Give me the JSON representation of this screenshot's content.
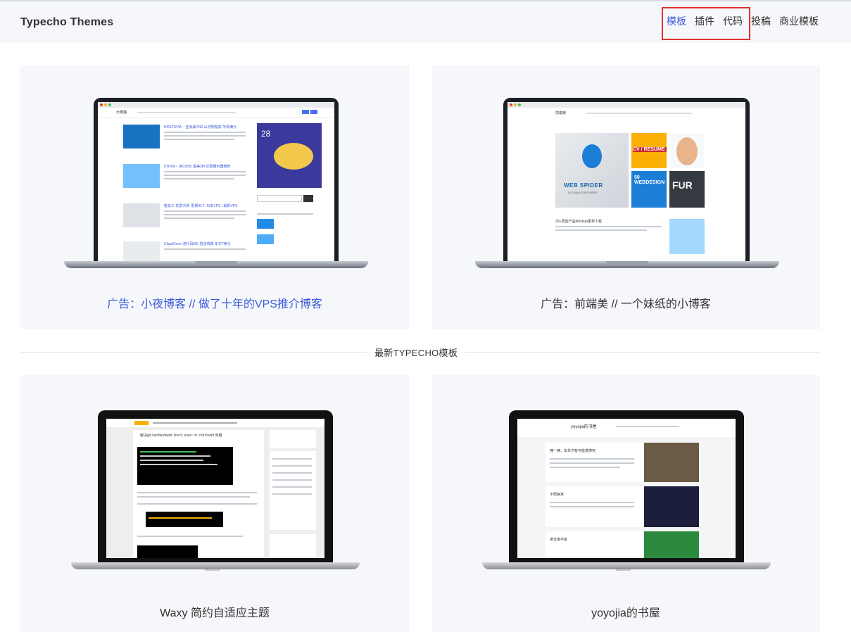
{
  "header": {
    "site_title": "Typecho Themes",
    "nav": [
      {
        "label": "模板",
        "active": true
      },
      {
        "label": "插件",
        "active": false
      },
      {
        "label": "代码",
        "active": false
      },
      {
        "label": "投稿",
        "active": false
      },
      {
        "label": "商业模板",
        "active": false
      }
    ]
  },
  "ads": [
    {
      "caption": "广告：小夜博客 // 做了十年的VPS推介博客",
      "is_link": true
    },
    {
      "caption": "广告：前端美 // 一个妹纸的小博客",
      "is_link": false
    }
  ],
  "section_title": "最新TYPECHO模板",
  "themes": [
    {
      "caption": "Waxy 简约自适应主题"
    },
    {
      "caption": "yoyojia的书屋"
    }
  ],
  "previews": {
    "card1": {
      "logo": "大眼猫",
      "date": "28",
      "posts": [
        "HOSTKVM – 亚洲最CN2 山河物理商 所得满元",
        "DIYVM – 用038元 最美2M 优惠服务器推荐",
        "搬瓦工 优惠75折 限量32个 日本VPS / 最新VPS",
        "CloudCone 洛杉矶MC 直送线路 年付7美元"
      ]
    },
    "card2": {
      "logo": "前端美",
      "post": "20+原创产品Mockup素材下载",
      "logo_text": "WEB SPIDER",
      "logo_sub": "SLOGAN GOES HERE",
      "tiles": [
        "CV / RESUME",
        "50 WEBDESIGN",
        "FUR"
      ]
    },
    "card3": {
      "title": "解决git /usr/bin/bash: line 0: exec: nc: not found 问题",
      "brand": "MacBook"
    },
    "card4": {
      "title": "yoyojia的书屋",
      "posts": [
        "拥一拥，年年才有可能发撑死",
        "不限宫家",
        "常去练手客"
      ],
      "brand": "MacBook"
    }
  },
  "colors": {
    "accent": "#3b5bdb",
    "highlight": "#e03131",
    "card_bg": "#f5f7fa"
  }
}
